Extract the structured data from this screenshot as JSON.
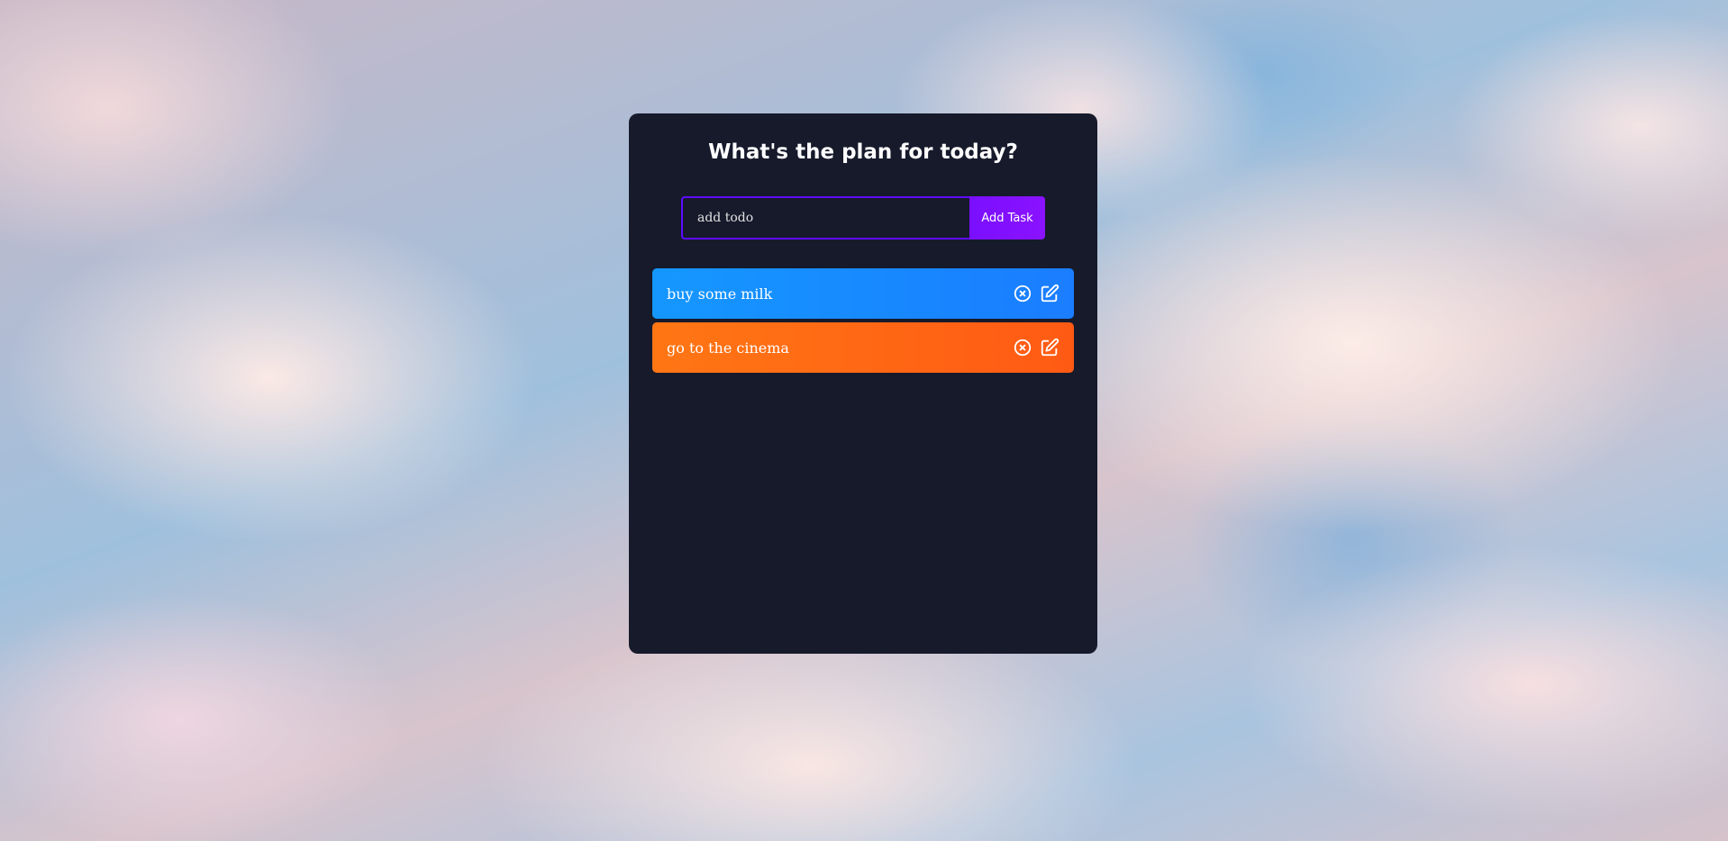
{
  "app": {
    "title": "What's the plan for today?"
  },
  "form": {
    "input_value": "",
    "input_placeholder": "add todo",
    "add_button_label": "Add Task"
  },
  "todos": [
    {
      "text": "buy some milk",
      "color": "blue",
      "remove_icon": "close-circle-icon",
      "edit_icon": "edit-icon"
    },
    {
      "text": "go to the cinema",
      "color": "orange",
      "remove_icon": "close-circle-icon",
      "edit_icon": "edit-icon"
    }
  ],
  "colors": {
    "panel": "#161a2b",
    "accent": "#5d0cff",
    "button": "#7a0fff",
    "todo_blue": "#1597ff",
    "todo_orange": "#ff7614"
  }
}
